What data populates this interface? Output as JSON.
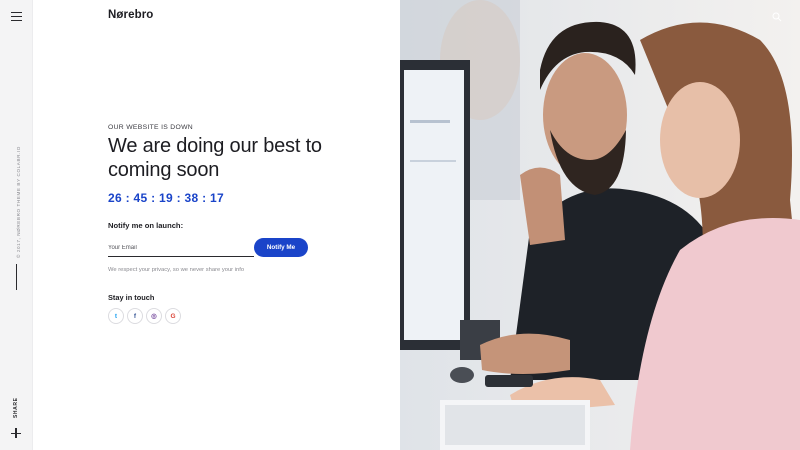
{
  "brand": {
    "logo": "Nørebro"
  },
  "rail": {
    "copyright": "© 2017, NØREBRO THEME BY COLABR.IO",
    "share_label": "SHARE"
  },
  "main": {
    "eyebrow": "OUR WEBSITE IS DOWN",
    "headline": "We are doing our best to coming soon",
    "countdown": "26 : 45 : 19 : 38 : 17",
    "notify_label": "Notify me on launch:",
    "email_placeholder": "Your Email",
    "email_value": "",
    "notify_button": "Notify Me",
    "privacy": "We respect your privacy, so we never share your info",
    "stay_label": "Stay in touch"
  },
  "socials": [
    {
      "name": "twitter",
      "glyph": "t"
    },
    {
      "name": "facebook",
      "glyph": "f"
    },
    {
      "name": "instagram",
      "glyph": "◎"
    },
    {
      "name": "google",
      "glyph": "G"
    }
  ],
  "icons": {
    "menu": "menu-icon",
    "plus": "plus-icon",
    "search": "search-icon"
  },
  "colors": {
    "accent": "#1a44c9",
    "rail_bg": "#f4f4f5",
    "text": "#1d1d22"
  }
}
